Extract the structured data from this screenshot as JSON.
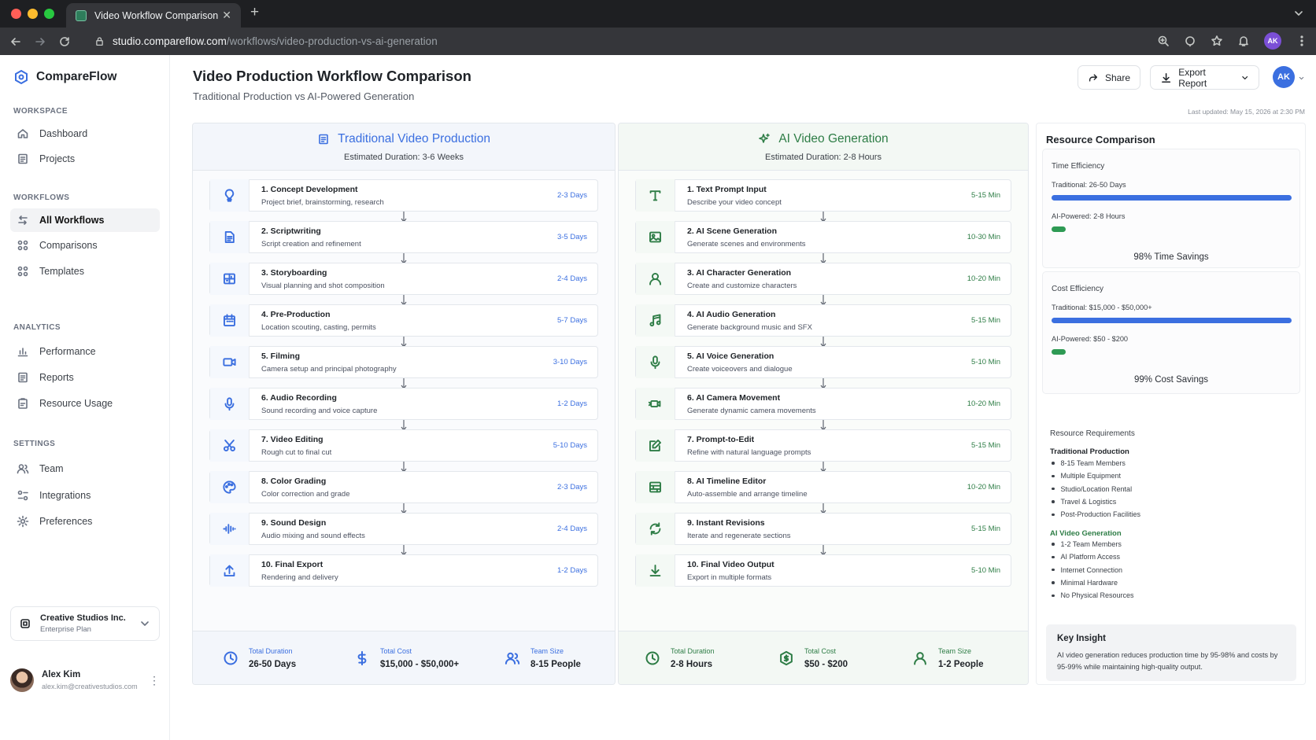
{
  "browser": {
    "tab_title": "Video Workflow Comparison",
    "url_host": "studio.compareflow.com",
    "url_path": "/workflows/video-production-vs-ai-generation",
    "profile_initials": "AK"
  },
  "sidebar": {
    "brand": "CompareFlow",
    "sections": [
      {
        "title": "WORKSPACE",
        "items": [
          {
            "label": "Dashboard",
            "icon": "home-icon"
          },
          {
            "label": "Projects",
            "icon": "file-icon"
          }
        ]
      },
      {
        "title": "WORKFLOWS",
        "items": [
          {
            "label": "All Workflows",
            "icon": "arrows-icon",
            "active": true
          },
          {
            "label": "Comparisons",
            "icon": "compare-icon"
          },
          {
            "label": "Templates",
            "icon": "grid-icon"
          }
        ]
      },
      {
        "title": "ANALYTICS",
        "items": [
          {
            "label": "Performance",
            "icon": "bar-chart-icon"
          },
          {
            "label": "Reports",
            "icon": "report-icon"
          },
          {
            "label": "Resource Usage",
            "icon": "clipboard-icon"
          }
        ]
      },
      {
        "title": "SETTINGS",
        "items": [
          {
            "label": "Team",
            "icon": "team-icon"
          },
          {
            "label": "Integrations",
            "icon": "integrations-icon"
          },
          {
            "label": "Preferences",
            "icon": "gear-icon"
          }
        ]
      }
    ],
    "org": {
      "name": "Creative Studios Inc.",
      "plan": "Enterprise Plan"
    },
    "user": {
      "name": "Alex Kim",
      "email": "alex.kim@creativestudios.com"
    }
  },
  "header": {
    "title": "Video Production Workflow Comparison",
    "subtitle": "Traditional Production vs AI-Powered Generation",
    "share_label": "Share",
    "export_label": "Export Report",
    "avatar": "AK",
    "last_updated": "Last updated: May 15, 2026 at 2:30 PM"
  },
  "traditional": {
    "title": "Traditional Video Production",
    "duration": "Estimated Duration: 3-6 Weeks",
    "steps": [
      {
        "name": "1. Concept Development",
        "desc": "Project brief, brainstorming, research",
        "dur": "2-3 Days",
        "icon": "lightbulb-icon"
      },
      {
        "name": "2. Scriptwriting",
        "desc": "Script creation and refinement",
        "dur": "3-5 Days",
        "icon": "document-icon"
      },
      {
        "name": "3. Storyboarding",
        "desc": "Visual planning and shot composition",
        "dur": "2-4 Days",
        "icon": "storyboard-icon"
      },
      {
        "name": "4. Pre-Production",
        "desc": "Location scouting, casting, permits",
        "dur": "5-7 Days",
        "icon": "calendar-icon"
      },
      {
        "name": "5. Filming",
        "desc": "Camera setup and principal photography",
        "dur": "3-10 Days",
        "icon": "video-camera-icon"
      },
      {
        "name": "6. Audio Recording",
        "desc": "Sound recording and voice capture",
        "dur": "1-2 Days",
        "icon": "microphone-icon"
      },
      {
        "name": "7. Video Editing",
        "desc": "Rough cut to final cut",
        "dur": "5-10 Days",
        "icon": "scissors-icon"
      },
      {
        "name": "8. Color Grading",
        "desc": "Color correction and grade",
        "dur": "2-3 Days",
        "icon": "palette-icon"
      },
      {
        "name": "9. Sound Design",
        "desc": "Audio mixing and sound effects",
        "dur": "2-4 Days",
        "icon": "waveform-icon"
      },
      {
        "name": "10. Final Export",
        "desc": "Rendering and delivery",
        "dur": "1-2 Days",
        "icon": "upload-icon"
      }
    ],
    "footer": [
      {
        "label": "Total Duration",
        "value": "26-50 Days",
        "icon": "clock-icon"
      },
      {
        "label": "Total Cost",
        "value": "$15,000 - $50,000+",
        "icon": "dollar-icon"
      },
      {
        "label": "Team Size",
        "value": "8-15 People",
        "icon": "team-icon"
      }
    ]
  },
  "ai": {
    "title": "AI Video Generation",
    "duration": "Estimated Duration: 2-8 Hours",
    "steps": [
      {
        "name": "1. Text Prompt Input",
        "desc": "Describe your video concept",
        "dur": "5-15 Min",
        "icon": "text-icon"
      },
      {
        "name": "2. AI Scene Generation",
        "desc": "Generate scenes and environments",
        "dur": "10-30 Min",
        "icon": "image-icon"
      },
      {
        "name": "3. AI Character Generation",
        "desc": "Create and customize characters",
        "dur": "10-20 Min",
        "icon": "person-icon"
      },
      {
        "name": "4. AI Audio Generation",
        "desc": "Generate background music and SFX",
        "dur": "5-15 Min",
        "icon": "music-note-icon"
      },
      {
        "name": "5. AI Voice Generation",
        "desc": "Create voiceovers and dialogue",
        "dur": "5-10 Min",
        "icon": "microphone-icon"
      },
      {
        "name": "6. AI Camera Movement",
        "desc": "Generate dynamic camera movements",
        "dur": "10-20 Min",
        "icon": "camera-move-icon"
      },
      {
        "name": "7. Prompt-to-Edit",
        "desc": "Refine with natural language prompts",
        "dur": "5-15 Min",
        "icon": "edit-icon"
      },
      {
        "name": "8. AI Timeline Editor",
        "desc": "Auto-assemble and arrange timeline",
        "dur": "10-20 Min",
        "icon": "timeline-icon"
      },
      {
        "name": "9. Instant Revisions",
        "desc": "Iterate and regenerate sections",
        "dur": "5-15 Min",
        "icon": "refresh-icon"
      },
      {
        "name": "10. Final Video Output",
        "desc": "Export in multiple formats",
        "dur": "5-10 Min",
        "icon": "download-icon"
      }
    ],
    "footer": [
      {
        "label": "Total Duration",
        "value": "2-8 Hours",
        "icon": "clock-icon"
      },
      {
        "label": "Total Cost",
        "value": "$50 - $200",
        "icon": "coin-icon"
      },
      {
        "label": "Team Size",
        "value": "1-2 People",
        "icon": "person-icon"
      }
    ]
  },
  "resource": {
    "title": "Resource Comparison",
    "time": {
      "label": "Time Efficiency",
      "trad_text": "Traditional: 26-50 Days",
      "ai_text": "AI-Powered: 2-8 Hours",
      "trad_fraction": 1.0,
      "ai_fraction": 0.06,
      "savings": "98% Time Savings"
    },
    "cost": {
      "label": "Cost Efficiency",
      "trad_text": "Traditional: $15,000 - $50,000+",
      "ai_text": "AI-Powered: $50 - $200",
      "trad_fraction": 1.0,
      "ai_fraction": 0.06,
      "savings": "99% Cost Savings"
    },
    "req_title": "Resource Requirements",
    "trad_req_title": "Traditional Production",
    "trad_req": [
      "8-15 Team Members",
      "Multiple Equipment",
      "Studio/Location Rental",
      "Travel & Logistics",
      "Post-Production Facilities"
    ],
    "ai_req_title": "AI Video Generation",
    "ai_req": [
      "1-2 Team Members",
      "AI Platform Access",
      "Internet Connection",
      "Minimal Hardware",
      "No Physical Resources"
    ],
    "insight_title": "Key Insight",
    "insight_text": "AI video generation reduces production time by 95-98% and costs by 95-99% while maintaining high-quality output."
  },
  "colors": {
    "trad_accent": "#3b6fe0",
    "ai_accent": "#2e7d46",
    "ai_bar": "#2e9a54"
  }
}
